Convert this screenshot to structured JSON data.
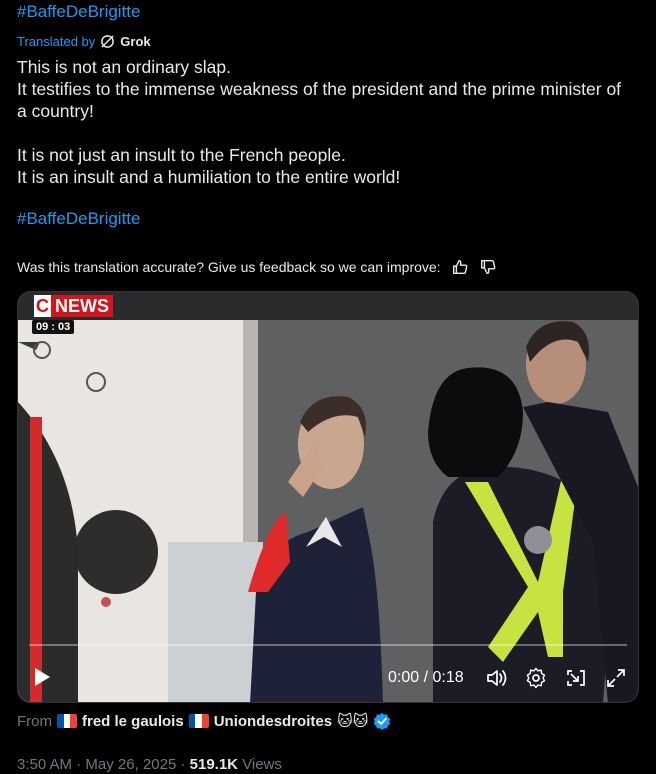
{
  "tweet": {
    "top_hashtag": "#BaffeDeBrigitte",
    "translated_label": "Translated by",
    "translator_name": "Grok",
    "paragraph_1_line_1": "This is not an ordinary slap.",
    "paragraph_1_line_2": "It testifies to the immense weakness of the president and the prime minister of a country!",
    "paragraph_2_line_1": "It is not just an insult to the French people.",
    "paragraph_2_line_2": "It is an insult and a humiliation to the entire world!",
    "bottom_hashtag": "#BaffeDeBrigitte"
  },
  "feedback": {
    "question": "Was this translation accurate? Give us feedback so we can improve:",
    "thumbs_up_icon": "thumbs-up-icon",
    "thumbs_down_icon": "thumbs-down-icon"
  },
  "video": {
    "channel_logo_c": "C",
    "channel_logo_news": "NEWS",
    "broadcast_time": "09 : 03",
    "time_readout": "0:00 / 0:18",
    "progress_fraction": 0.0,
    "controls": [
      "play-icon",
      "volume-icon",
      "settings-icon",
      "pip-icon",
      "fullscreen-icon"
    ]
  },
  "source": {
    "from_label": "From",
    "user_name_1": "fred le gaulois",
    "user_name_2": "Uniondesdroites",
    "emoji": "🐱🐱",
    "flag_colors": [
      "#0055a4",
      "#ffffff",
      "#ef4135"
    ],
    "verified_color": "#1d9bf0"
  },
  "meta": {
    "time": "3:50 AM",
    "separator": "·",
    "date": "May 26, 2025",
    "views_count": "519.1K",
    "views_label": "Views"
  }
}
